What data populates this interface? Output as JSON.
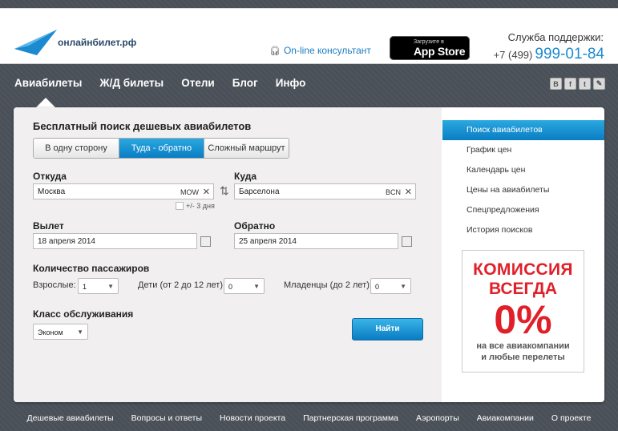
{
  "header": {
    "logo_text": "онлайнбилет.рф",
    "consultant": "On-line консультант",
    "appstore_small": "Загрузите в",
    "appstore_big": "App Store",
    "support_label": "Служба поддержки:",
    "phone_prefix": "+7 (499)",
    "phone_main": "999-01-84"
  },
  "nav": {
    "items": [
      "Авиабилеты",
      "Ж/Д билеты",
      "Отели",
      "Блог",
      "Инфо"
    ],
    "social": [
      "B",
      "f",
      "t",
      "✎"
    ]
  },
  "form": {
    "title": "Бесплатный поиск дешевых авиабилетов",
    "tabs": [
      "В одну сторону",
      "Туда - обратно",
      "Сложный маршрут"
    ],
    "from_label": "Откуда",
    "from_value": "Москва",
    "from_code": "MOW",
    "to_label": "Куда",
    "to_value": "Барселона",
    "to_code": "BCN",
    "flex_dates": "+/- 3 дня",
    "depart_label": "Вылет",
    "depart_value": "18 апреля 2014",
    "return_label": "Обратно",
    "return_value": "25 апреля 2014",
    "passengers_label": "Количество пассажиров",
    "adults_label": "Взрослые:",
    "adults_value": "1",
    "children_label": "Дети (от 2 до 12 лет):",
    "children_value": "0",
    "infants_label": "Младенцы (до 2 лет):",
    "infants_value": "0",
    "class_label": "Класс обслуживания",
    "class_value": "Эконом",
    "find_button": "Найти"
  },
  "side_menu": {
    "items": [
      "Поиск авиабилетов",
      "График цен",
      "Календарь цен",
      "Цены на авиабилеты",
      "Спецпредложения",
      "История поисков"
    ]
  },
  "promo": {
    "line1": "КОМИССИЯ",
    "line2": "ВСЕГДА",
    "line3": "0%",
    "line4": "на все авиакомпании",
    "line5": "и любые перелеты"
  },
  "footer": {
    "links": [
      "Дешевые авиабилеты",
      "Вопросы и ответы",
      "Новости проекта",
      "Партнерская программа",
      "Аэропорты",
      "Авиакомпании",
      "О проекте"
    ]
  },
  "colors": {
    "accent": "#0a7dc3",
    "promo_red": "#e01f29"
  }
}
